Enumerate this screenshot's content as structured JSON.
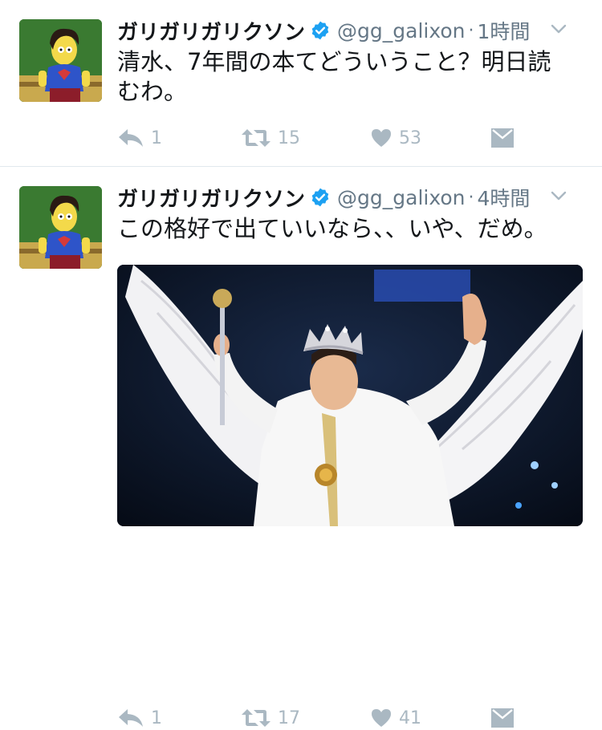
{
  "tweets": [
    {
      "name": "ガリガリガリクソン",
      "handle": "@gg_galixon",
      "separator": "·",
      "time": "1時間",
      "text": "清水、7年間の本てどういうこと？明日読むわ。",
      "replies": "1",
      "retweets": "15",
      "likes": "53"
    },
    {
      "name": "ガリガリガリクソン",
      "handle": "@gg_galixon",
      "separator": "·",
      "time": "4時間",
      "text": "この格好で出ていいなら、、いや、だめ。",
      "replies": "1",
      "retweets": "17",
      "likes": "41"
    }
  ],
  "colors": {
    "verified": "#1da1f2",
    "icon_gray": "#aab8c2",
    "secondary_text": "#657786"
  },
  "icons": [
    "reply-icon",
    "retweet-icon",
    "like-icon",
    "dm-icon",
    "verified-badge-icon",
    "chevron-down-icon"
  ]
}
